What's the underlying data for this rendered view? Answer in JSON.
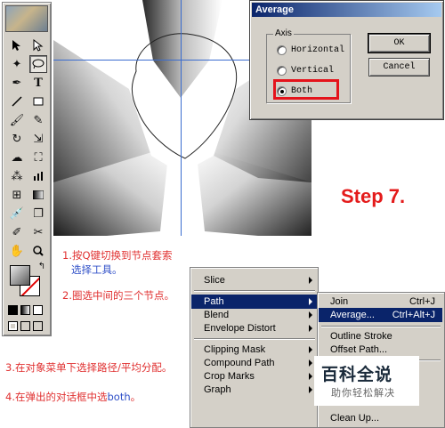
{
  "dialog": {
    "title": "Average",
    "axis_label": "Axis",
    "options": [
      {
        "label": "Horizontal",
        "selected": false
      },
      {
        "label": "Vertical",
        "selected": false
      },
      {
        "label": "Both",
        "selected": true
      }
    ],
    "ok_label": "OK",
    "cancel_label": "Cancel"
  },
  "step_label": "Step 7.",
  "instructions": [
    {
      "text": "1.按Q键切换到节点套索",
      "color": "#e03030"
    },
    {
      "text": "选择工具。",
      "color": "#3050c8"
    },
    {
      "text": "2.圈选中间的三个节点。",
      "color": "#e03030"
    },
    {
      "text": "3.在对象菜单下选择路径/平均分配。",
      "color": "#e03030"
    },
    {
      "text": "4.在弹出的对话框中选",
      "color": "#e03030"
    },
    {
      "text": "both",
      "color": "#3050c8"
    },
    {
      "text": "。",
      "color": "#e03030"
    }
  ],
  "object_menu": {
    "items": [
      {
        "label": "Slice",
        "submenu": true,
        "selected": false
      },
      {
        "label": "Path",
        "submenu": true,
        "selected": true
      },
      {
        "label": "Blend",
        "submenu": true,
        "selected": false
      },
      {
        "label": "Envelope Distort",
        "submenu": true,
        "selected": false
      },
      {
        "label": "Clipping Mask",
        "submenu": true,
        "selected": false
      },
      {
        "label": "Compound Path",
        "submenu": true,
        "selected": false
      },
      {
        "label": "Crop Marks",
        "submenu": true,
        "selected": false
      },
      {
        "label": "Graph",
        "submenu": true,
        "selected": false
      }
    ]
  },
  "path_submenu": {
    "items": [
      {
        "label": "Join",
        "shortcut": "Ctrl+J",
        "selected": false
      },
      {
        "label": "Average...",
        "shortcut": "Ctrl+Alt+J",
        "selected": true
      },
      {
        "label": "Outline Stroke",
        "shortcut": "",
        "selected": false
      },
      {
        "label": "Offset Path...",
        "shortcut": "",
        "selected": false
      },
      {
        "label": "Clean Up...",
        "shortcut": "",
        "selected": false
      }
    ]
  },
  "watermark": {
    "main": "百科全说",
    "sub": "助你轻松解决"
  },
  "colors": {
    "highlight": "#e4131b",
    "menu_selection": "#0a246a",
    "dialog_bg": "#d4d0c8",
    "guide": "#3a6ccf"
  },
  "toolbox": {
    "icons": [
      "selection-icon",
      "direct-selection-icon",
      "magic-wand-icon",
      "lasso-icon",
      "pen-icon",
      "type-icon",
      "line-icon",
      "rectangle-icon",
      "paintbrush-icon",
      "pencil-icon",
      "rotate-icon",
      "scale-icon",
      "warp-icon",
      "free-transform-icon",
      "symbol-sprayer-icon",
      "graph-icon",
      "mesh-icon",
      "gradient-icon",
      "eyedropper-icon",
      "blend-icon",
      "slice-icon",
      "scissors-icon",
      "hand-icon",
      "zoom-icon"
    ]
  }
}
